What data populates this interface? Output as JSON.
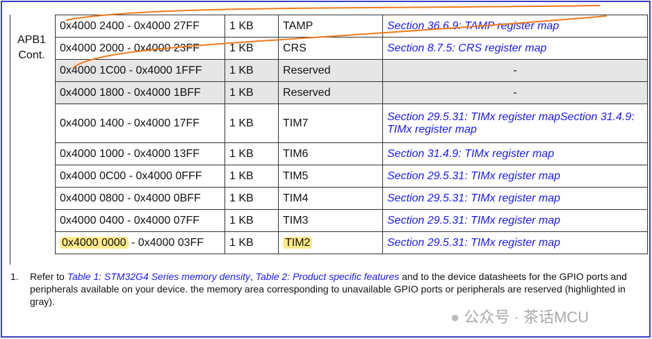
{
  "group_label": [
    "APB1",
    "Cont."
  ],
  "rows": [
    {
      "range": "0x4000 2400 - 0x4000 27FF",
      "size": "1 KB",
      "periph": "TAMP",
      "ref": "Section 36.6.9: TAMP register map",
      "gray": false
    },
    {
      "range": "0x4000 2000 - 0x4000 23FF",
      "size": "1 KB",
      "periph": "CRS",
      "ref": "Section 8.7.5: CRS register map",
      "gray": false
    },
    {
      "range": "0x4000 1C00 - 0x4000 1FFF",
      "size": "1 KB",
      "periph": "Reserved",
      "ref": "-",
      "gray": true
    },
    {
      "range": "0x4000 1800 - 0x4000 1BFF",
      "size": "1 KB",
      "periph": "Reserved",
      "ref": "-",
      "gray": true
    },
    {
      "range": "0x4000 1400 - 0x4000 17FF",
      "size": "1 KB",
      "periph": "TIM7",
      "ref": "Section 29.5.31: TIMx register mapSection 31.4.9: TIMx register map",
      "gray": false
    },
    {
      "range": "0x4000 1000 - 0x4000 13FF",
      "size": "1 KB",
      "periph": "TIM6",
      "ref": "Section 31.4.9: TIMx register map",
      "gray": false
    },
    {
      "range": "0x4000 0C00 - 0x4000 0FFF",
      "size": "1 KB",
      "periph": "TIM5",
      "ref": "Section 29.5.31: TIMx register map",
      "gray": false
    },
    {
      "range": "0x4000 0800 - 0x4000 0BFF",
      "size": "1 KB",
      "periph": "TIM4",
      "ref": "Section 29.5.31: TIMx register map",
      "gray": false
    },
    {
      "range": "0x4000 0400 - 0x4000 07FF",
      "size": "1 KB",
      "periph": "TIM3",
      "ref": "Section 29.5.31: TIMx register map",
      "gray": false
    }
  ],
  "last_row": {
    "range_start": "0x4000 0000",
    "range_rest": " - 0x4000 03FF",
    "size": "1 KB",
    "periph": "TIM2",
    "ref": "Section 29.5.31: TIMx register map"
  },
  "note": {
    "num": "1.",
    "pre": "Refer to ",
    "link1": "Table 1: STM32G4 Series memory density",
    "sep": ", ",
    "link2": "Table 2: Product specific features",
    "post": " and to the device datasheets for the GPIO ports and peripherals available on your device. the memory area corresponding to unavailable GPIO ports or peripherals are reserved (highlighted in gray)."
  },
  "watermark": "公众号 · 茶话MCU",
  "colors": {
    "border": "#3a3fc8",
    "link": "#1a1aff",
    "highlight": "#ffe98a",
    "annotation": "#f07a1a"
  }
}
